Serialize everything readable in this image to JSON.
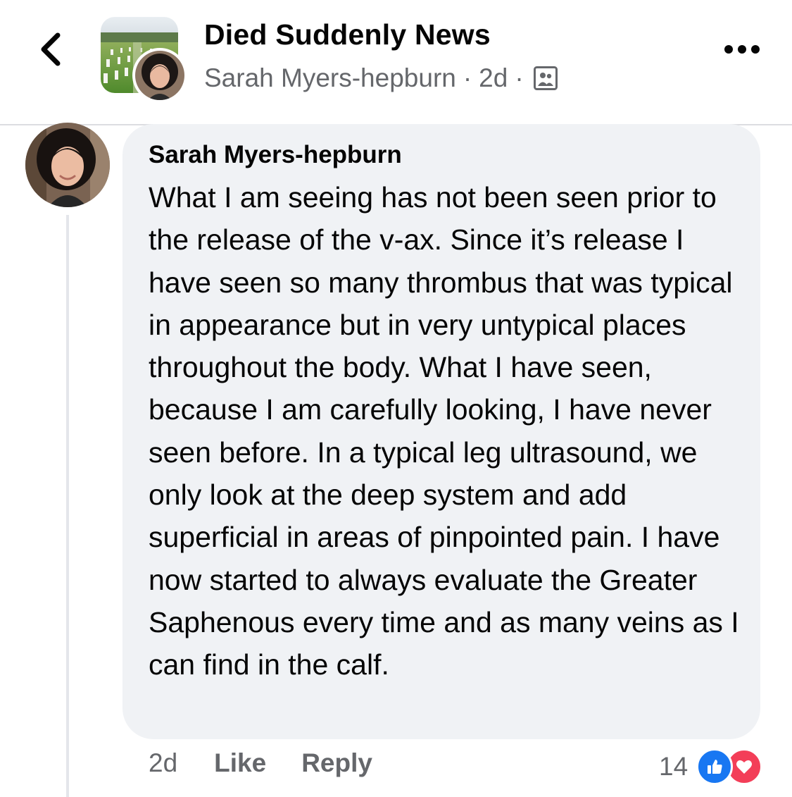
{
  "header": {
    "group_name": "Died Suddenly News",
    "poster_name": "Sarah Myers-hepburn",
    "separator": "·",
    "time": "2d",
    "audience_icon": "group-members-icon",
    "back_icon": "chevron-left-icon",
    "more_icon": "more-horizontal-icon"
  },
  "comment": {
    "author": "Sarah Myers-hepburn",
    "text": "What I am seeing has not been seen prior to the release of the v-ax. Since it’s release I have seen so many thrombus that was typical in appearance but in very untypical places throughout the body. What I have seen, because I am carefully looking, I have never seen before. In a typical leg ultrasound, we only look at the deep system and add superficial in areas of pinpointed pain. I have now started to always evaluate the Greater Saphenous every time and as many veins as I can find in the calf.",
    "time": "2d",
    "like_label": "Like",
    "reply_label": "Reply",
    "reaction_count": "14",
    "reactions": [
      "like",
      "love"
    ]
  },
  "colors": {
    "bubble_bg": "#f0f2f5",
    "meta_text": "#65676b",
    "like_blue": "#1877f2",
    "love_red": "#f33e58",
    "divider": "#dcdde1"
  }
}
